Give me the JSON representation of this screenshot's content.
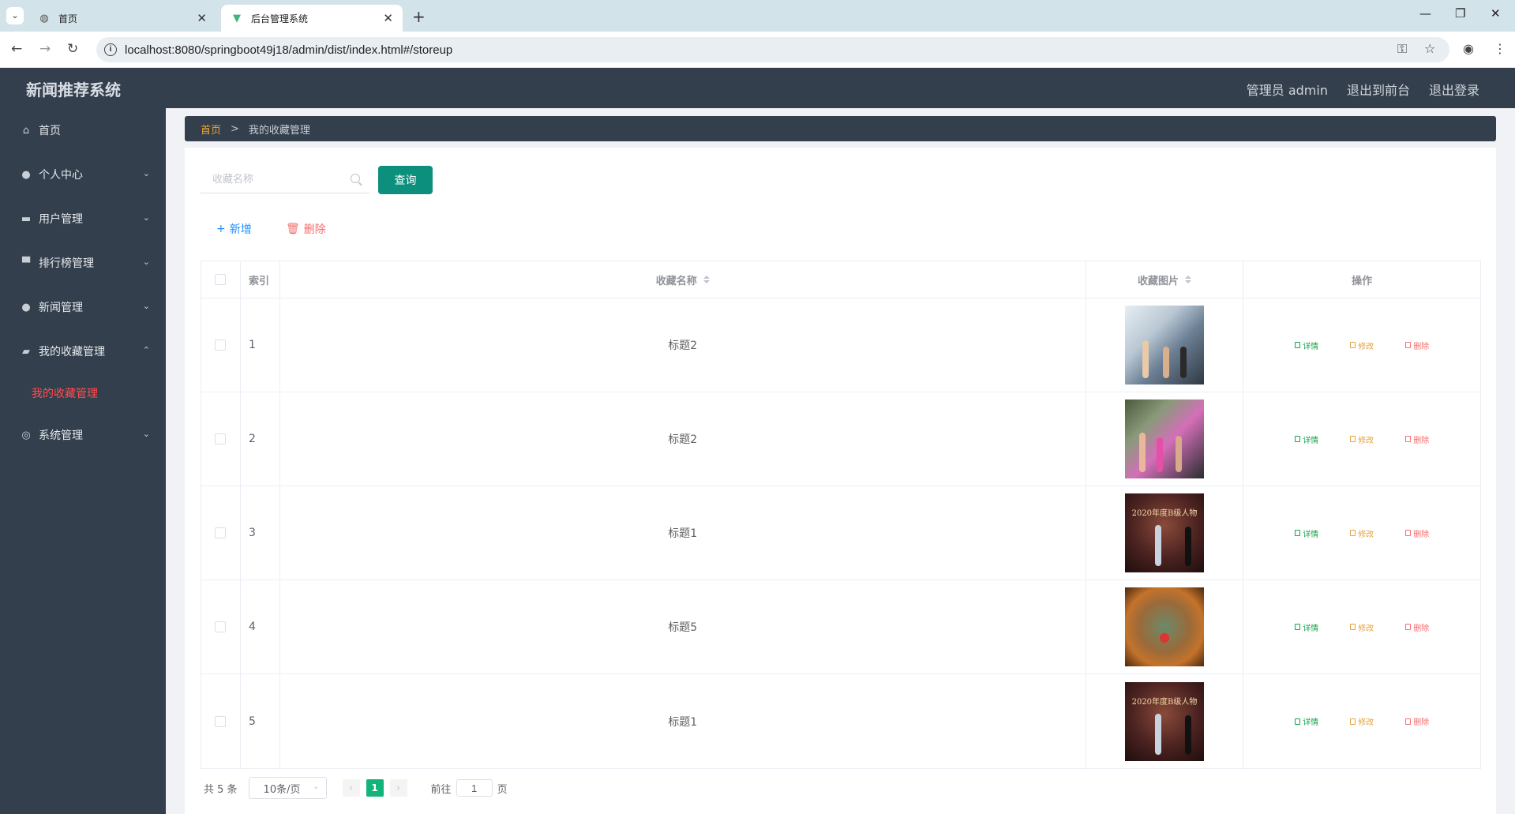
{
  "browser": {
    "tabs": [
      {
        "label": "首页",
        "icon": "globe-icon"
      },
      {
        "label": "后台管理系统",
        "icon": "vue-logo-icon"
      }
    ],
    "url": "localhost:8080/springboot49j18/admin/dist/index.html#/storeup"
  },
  "header": {
    "title": "新闻推荐系统",
    "user": "管理员 admin",
    "to_front": "退出到前台",
    "logout": "退出登录"
  },
  "sidebar": {
    "items": [
      {
        "label": "首页",
        "icon": "home-icon"
      },
      {
        "label": "个人中心",
        "icon": "user-icon"
      },
      {
        "label": "用户管理",
        "icon": "users-icon"
      },
      {
        "label": "排行榜管理",
        "icon": "monitor-icon"
      },
      {
        "label": "新闻管理",
        "icon": "bulb-icon"
      },
      {
        "label": "我的收藏管理",
        "icon": "ticket-icon",
        "expanded": true
      },
      {
        "label": "系统管理",
        "icon": "compass-icon"
      }
    ],
    "submenu_active": "我的收藏管理"
  },
  "breadcrumb": {
    "home": "首页",
    "separator": ">",
    "current": "我的收藏管理"
  },
  "search": {
    "placeholder": "收藏名称",
    "query_label": "查询"
  },
  "actions": {
    "add_label": "新增",
    "delete_label": "删除"
  },
  "table": {
    "headers": {
      "index": "索引",
      "name": "收藏名称",
      "image": "收藏图片",
      "ops": "操作"
    },
    "rows": [
      {
        "index": "1",
        "name": "标题2",
        "image": "gym-cycling-photo"
      },
      {
        "index": "2",
        "name": "标题2",
        "image": "gym-women-photo"
      },
      {
        "index": "3",
        "name": "标题1",
        "image": "award-stage-photo"
      },
      {
        "index": "4",
        "name": "标题5",
        "image": "bronze-mask-photo"
      },
      {
        "index": "5",
        "name": "标题1",
        "image": "award-stage-photo"
      }
    ],
    "op_labels": {
      "detail": "详情",
      "edit": "修改",
      "remove": "删除"
    },
    "stage_caption": "2020年度B级人物"
  },
  "pagination": {
    "total": "共 5 条",
    "page_size": "10条/页",
    "current": "1",
    "goto_prefix": "前往",
    "goto_value": "1",
    "goto_suffix": "页"
  },
  "colors": {
    "header_bg": "#333f4d",
    "accent_green": "#0d8f7e",
    "active_page": "#13b47c",
    "active_menu": "#ff4d4f",
    "breadcrumb_home": "#f0a62f"
  }
}
